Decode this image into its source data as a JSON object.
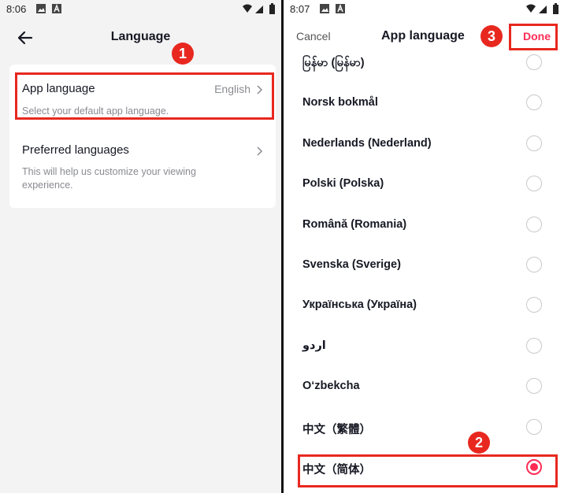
{
  "left": {
    "status_time": "8:06",
    "title": "Language",
    "app_language": {
      "title": "App language",
      "value": "English",
      "subtitle": "Select your default app language."
    },
    "preferred_languages": {
      "title": "Preferred languages",
      "subtitle": "This will help us customize your viewing experience."
    }
  },
  "right": {
    "status_time": "8:07",
    "cancel_label": "Cancel",
    "title": "App language",
    "done_label": "Done",
    "languages": [
      {
        "label": "မြန်မာ (မြန်မာ)",
        "selected": false
      },
      {
        "label": "Norsk bokmål",
        "selected": false
      },
      {
        "label": "Nederlands (Nederland)",
        "selected": false
      },
      {
        "label": "Polski (Polska)",
        "selected": false
      },
      {
        "label": "Română (Romania)",
        "selected": false
      },
      {
        "label": "Svenska (Sverige)",
        "selected": false
      },
      {
        "label": "Українська (Україна)",
        "selected": false
      },
      {
        "label": "اردو",
        "selected": false
      },
      {
        "label": "O‘zbekcha",
        "selected": false
      },
      {
        "label": "中文（繁體）",
        "selected": false
      },
      {
        "label": "中文（简体）",
        "selected": true
      }
    ]
  },
  "annotations": {
    "step1": "1",
    "step2": "2",
    "step3": "3",
    "color": "#e8281f"
  },
  "colors": {
    "accent": "#fe2c55",
    "highlight": "#e8281f"
  }
}
